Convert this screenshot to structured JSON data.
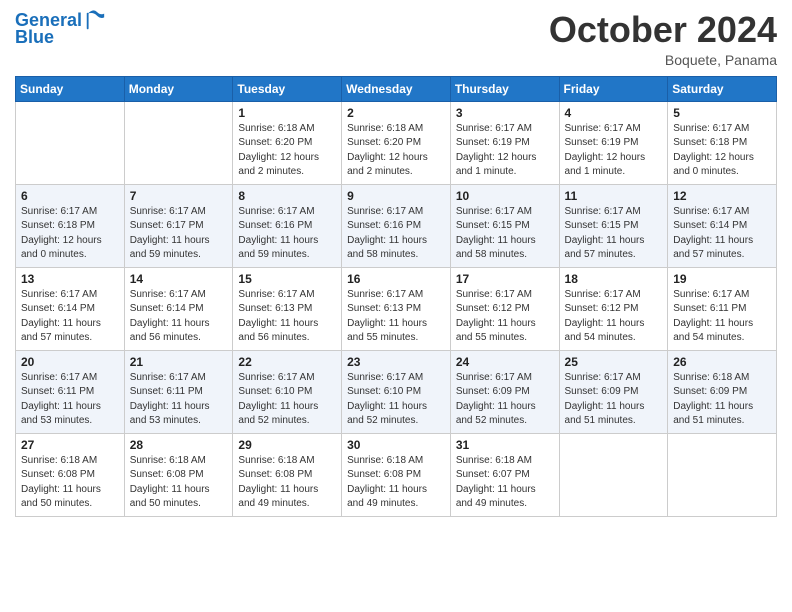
{
  "header": {
    "logo_line1": "General",
    "logo_line2": "Blue",
    "month": "October 2024",
    "location": "Boquete, Panama"
  },
  "weekdays": [
    "Sunday",
    "Monday",
    "Tuesday",
    "Wednesday",
    "Thursday",
    "Friday",
    "Saturday"
  ],
  "weeks": [
    [
      {
        "day": "",
        "info": ""
      },
      {
        "day": "",
        "info": ""
      },
      {
        "day": "1",
        "info": "Sunrise: 6:18 AM\nSunset: 6:20 PM\nDaylight: 12 hours and 2 minutes."
      },
      {
        "day": "2",
        "info": "Sunrise: 6:18 AM\nSunset: 6:20 PM\nDaylight: 12 hours and 2 minutes."
      },
      {
        "day": "3",
        "info": "Sunrise: 6:17 AM\nSunset: 6:19 PM\nDaylight: 12 hours and 1 minute."
      },
      {
        "day": "4",
        "info": "Sunrise: 6:17 AM\nSunset: 6:19 PM\nDaylight: 12 hours and 1 minute."
      },
      {
        "day": "5",
        "info": "Sunrise: 6:17 AM\nSunset: 6:18 PM\nDaylight: 12 hours and 0 minutes."
      }
    ],
    [
      {
        "day": "6",
        "info": "Sunrise: 6:17 AM\nSunset: 6:18 PM\nDaylight: 12 hours and 0 minutes."
      },
      {
        "day": "7",
        "info": "Sunrise: 6:17 AM\nSunset: 6:17 PM\nDaylight: 11 hours and 59 minutes."
      },
      {
        "day": "8",
        "info": "Sunrise: 6:17 AM\nSunset: 6:16 PM\nDaylight: 11 hours and 59 minutes."
      },
      {
        "day": "9",
        "info": "Sunrise: 6:17 AM\nSunset: 6:16 PM\nDaylight: 11 hours and 58 minutes."
      },
      {
        "day": "10",
        "info": "Sunrise: 6:17 AM\nSunset: 6:15 PM\nDaylight: 11 hours and 58 minutes."
      },
      {
        "day": "11",
        "info": "Sunrise: 6:17 AM\nSunset: 6:15 PM\nDaylight: 11 hours and 57 minutes."
      },
      {
        "day": "12",
        "info": "Sunrise: 6:17 AM\nSunset: 6:14 PM\nDaylight: 11 hours and 57 minutes."
      }
    ],
    [
      {
        "day": "13",
        "info": "Sunrise: 6:17 AM\nSunset: 6:14 PM\nDaylight: 11 hours and 57 minutes."
      },
      {
        "day": "14",
        "info": "Sunrise: 6:17 AM\nSunset: 6:14 PM\nDaylight: 11 hours and 56 minutes."
      },
      {
        "day": "15",
        "info": "Sunrise: 6:17 AM\nSunset: 6:13 PM\nDaylight: 11 hours and 56 minutes."
      },
      {
        "day": "16",
        "info": "Sunrise: 6:17 AM\nSunset: 6:13 PM\nDaylight: 11 hours and 55 minutes."
      },
      {
        "day": "17",
        "info": "Sunrise: 6:17 AM\nSunset: 6:12 PM\nDaylight: 11 hours and 55 minutes."
      },
      {
        "day": "18",
        "info": "Sunrise: 6:17 AM\nSunset: 6:12 PM\nDaylight: 11 hours and 54 minutes."
      },
      {
        "day": "19",
        "info": "Sunrise: 6:17 AM\nSunset: 6:11 PM\nDaylight: 11 hours and 54 minutes."
      }
    ],
    [
      {
        "day": "20",
        "info": "Sunrise: 6:17 AM\nSunset: 6:11 PM\nDaylight: 11 hours and 53 minutes."
      },
      {
        "day": "21",
        "info": "Sunrise: 6:17 AM\nSunset: 6:11 PM\nDaylight: 11 hours and 53 minutes."
      },
      {
        "day": "22",
        "info": "Sunrise: 6:17 AM\nSunset: 6:10 PM\nDaylight: 11 hours and 52 minutes."
      },
      {
        "day": "23",
        "info": "Sunrise: 6:17 AM\nSunset: 6:10 PM\nDaylight: 11 hours and 52 minutes."
      },
      {
        "day": "24",
        "info": "Sunrise: 6:17 AM\nSunset: 6:09 PM\nDaylight: 11 hours and 52 minutes."
      },
      {
        "day": "25",
        "info": "Sunrise: 6:17 AM\nSunset: 6:09 PM\nDaylight: 11 hours and 51 minutes."
      },
      {
        "day": "26",
        "info": "Sunrise: 6:18 AM\nSunset: 6:09 PM\nDaylight: 11 hours and 51 minutes."
      }
    ],
    [
      {
        "day": "27",
        "info": "Sunrise: 6:18 AM\nSunset: 6:08 PM\nDaylight: 11 hours and 50 minutes."
      },
      {
        "day": "28",
        "info": "Sunrise: 6:18 AM\nSunset: 6:08 PM\nDaylight: 11 hours and 50 minutes."
      },
      {
        "day": "29",
        "info": "Sunrise: 6:18 AM\nSunset: 6:08 PM\nDaylight: 11 hours and 49 minutes."
      },
      {
        "day": "30",
        "info": "Sunrise: 6:18 AM\nSunset: 6:08 PM\nDaylight: 11 hours and 49 minutes."
      },
      {
        "day": "31",
        "info": "Sunrise: 6:18 AM\nSunset: 6:07 PM\nDaylight: 11 hours and 49 minutes."
      },
      {
        "day": "",
        "info": ""
      },
      {
        "day": "",
        "info": ""
      }
    ]
  ]
}
